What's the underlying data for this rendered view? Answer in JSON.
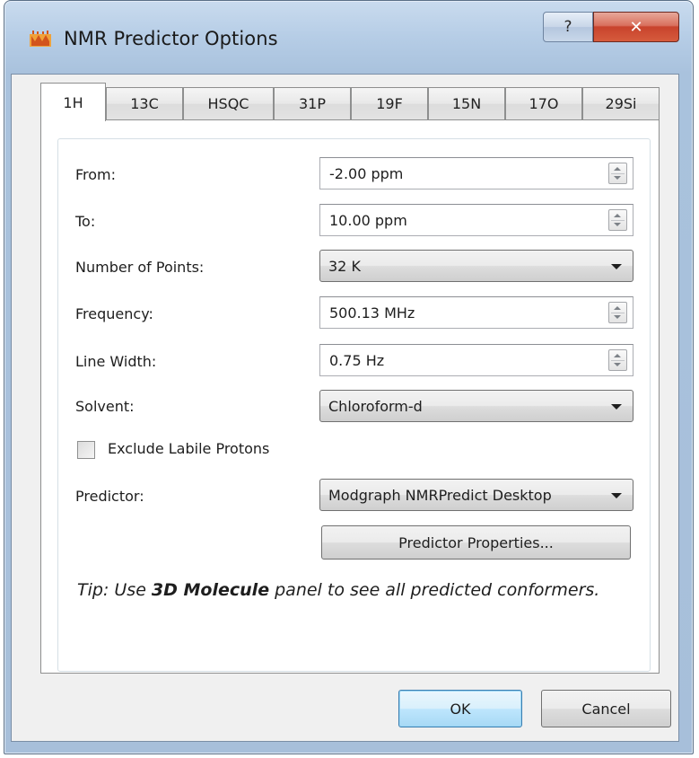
{
  "window": {
    "title": "NMR Predictor Options",
    "help_label": "?",
    "close_label": "✕"
  },
  "tabs": [
    {
      "label": "1H",
      "active": true
    },
    {
      "label": "13C",
      "active": false
    },
    {
      "label": "HSQC",
      "active": false
    },
    {
      "label": "31P",
      "active": false
    },
    {
      "label": "19F",
      "active": false
    },
    {
      "label": "15N",
      "active": false
    },
    {
      "label": "17O",
      "active": false
    },
    {
      "label": "29Si",
      "active": false
    }
  ],
  "form": {
    "from": {
      "label": "From:",
      "value": "-2.00 ppm"
    },
    "to": {
      "label": "To:",
      "value": "10.00 ppm"
    },
    "points": {
      "label": "Number of Points:",
      "value": "32 K"
    },
    "frequency": {
      "label": "Frequency:",
      "value": "500.13 MHz"
    },
    "line_width": {
      "label": "Line Width:",
      "value": "0.75 Hz"
    },
    "solvent": {
      "label": "Solvent:",
      "value": "Chloroform-d"
    },
    "exclude_labile": {
      "label": "Exclude Labile Protons",
      "checked": false
    },
    "predictor": {
      "label": "Predictor:",
      "value": "Modgraph NMRPredict Desktop"
    },
    "predictor_properties_label": "Predictor Properties..."
  },
  "tip": {
    "prefix": "Tip: Use ",
    "emphasis": "3D Molecule",
    "suffix": " panel to see all predicted conformers."
  },
  "footer": {
    "ok_label": "OK",
    "cancel_label": "Cancel"
  },
  "colors": {
    "title_bar": "#b6cde6",
    "close_button": "#c8432c",
    "default_button_border": "#3c7fb1"
  },
  "icons": {
    "app": "mnova-app-icon",
    "help": "help-icon",
    "close": "close-icon",
    "spin": "spin-buttons",
    "dropdown": "dropdown-arrow-icon"
  }
}
